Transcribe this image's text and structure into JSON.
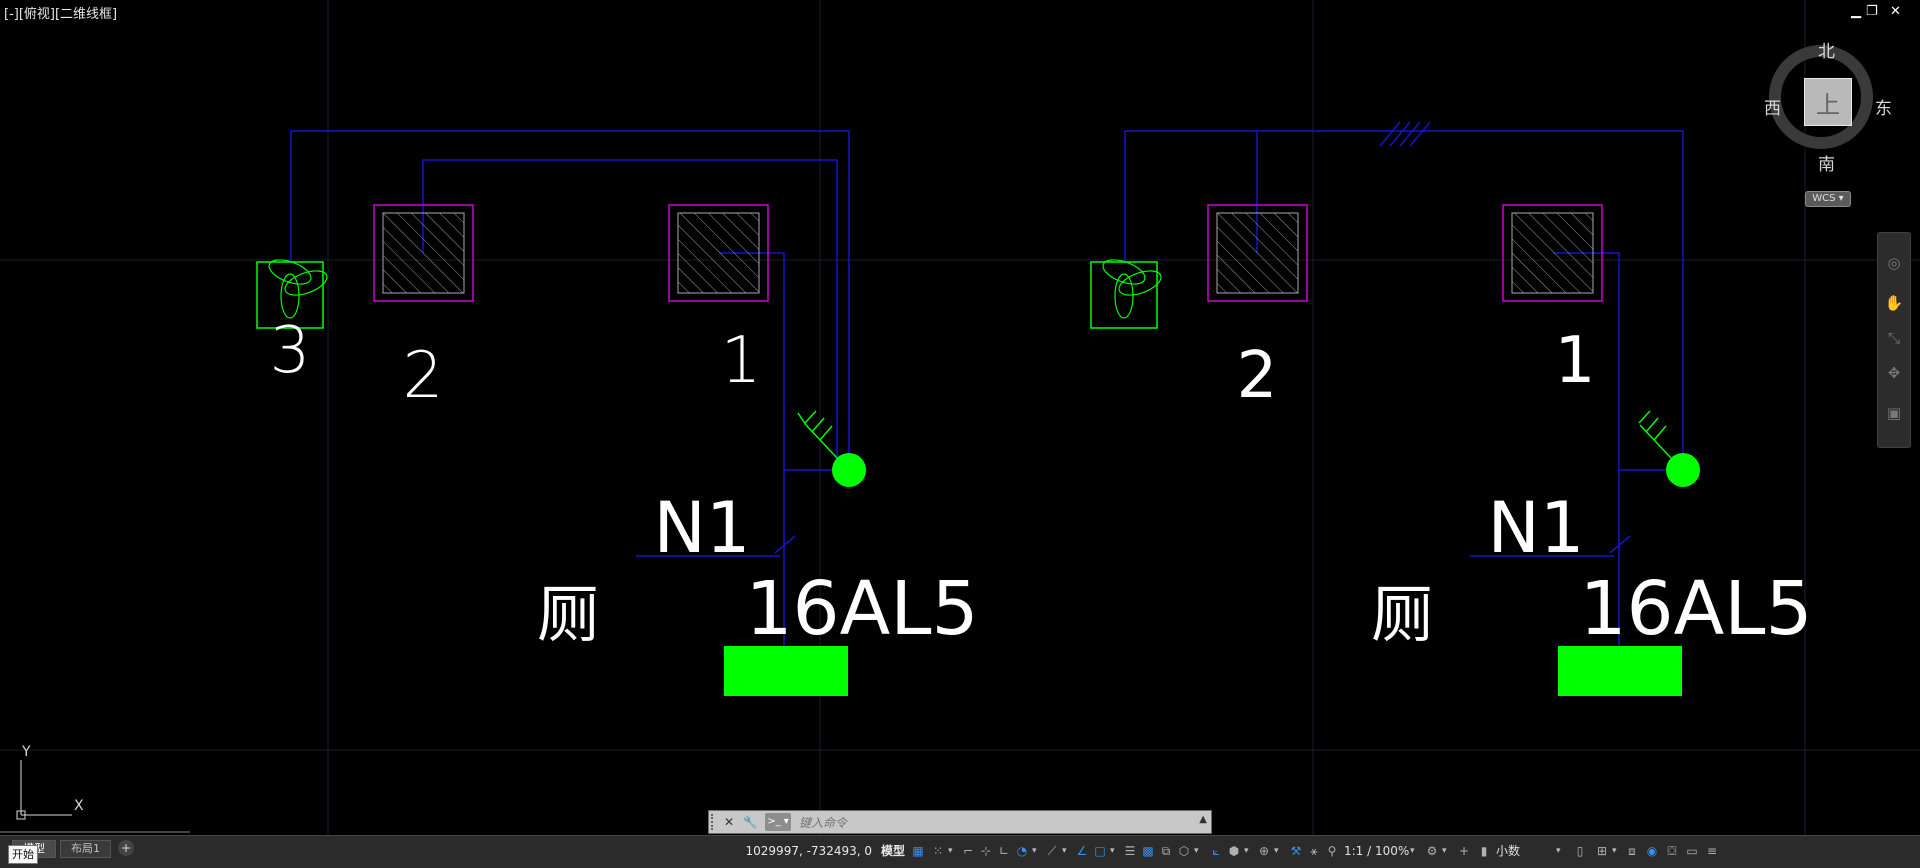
{
  "viewport": {
    "label": "[-][俯视][二维线框]",
    "minimize": "▁",
    "restore": "❐",
    "close": "✕"
  },
  "viewcube": {
    "top_face": "上",
    "north": "北",
    "south": "南",
    "east": "东",
    "west": "西",
    "wcs": "WCS ▾"
  },
  "ucs": {
    "y_label": "Y",
    "x_label": "X"
  },
  "drawing": {
    "left_group": {
      "labels": [
        "3",
        "2",
        "1"
      ],
      "feeder": "N1",
      "fan_text": "厕",
      "panel_code": "16AL5"
    },
    "right_group": {
      "labels": [
        "2",
        "1"
      ],
      "feeder": "N1",
      "fan_text": "厕",
      "panel_code": "16AL5"
    },
    "colors": {
      "wire": "#1414d2",
      "fixture_box": "#d000d0",
      "fan_switch": "#00ff00",
      "text": "#ffffff",
      "grid": "#1b2230"
    }
  },
  "command": {
    "close_btn": "✕",
    "settings_btn": "🔧",
    "prompt_btn": ">_ ▾",
    "placeholder": "键入命令",
    "history_btn": "▲"
  },
  "layouts": {
    "tabs": [
      "模型",
      "布局1"
    ],
    "add": "+",
    "start_tip": "开始"
  },
  "status": {
    "coordinates": "1029997, -732493, 0",
    "model": "模型",
    "scale": "1:1 / 100%",
    "units": "小数"
  },
  "icons": {
    "grid": "grid-icon",
    "snap": "snap-icon",
    "ortho": "ortho-icon",
    "polar": "polar-tracking-icon",
    "osnap": "object-snap-icon",
    "lineweight": "lineweight-icon",
    "transparency": "transparency-icon",
    "annotation": "annotation-scale-icon",
    "workspace": "workspace-gear-icon",
    "customize": "customize-menu-icon"
  }
}
